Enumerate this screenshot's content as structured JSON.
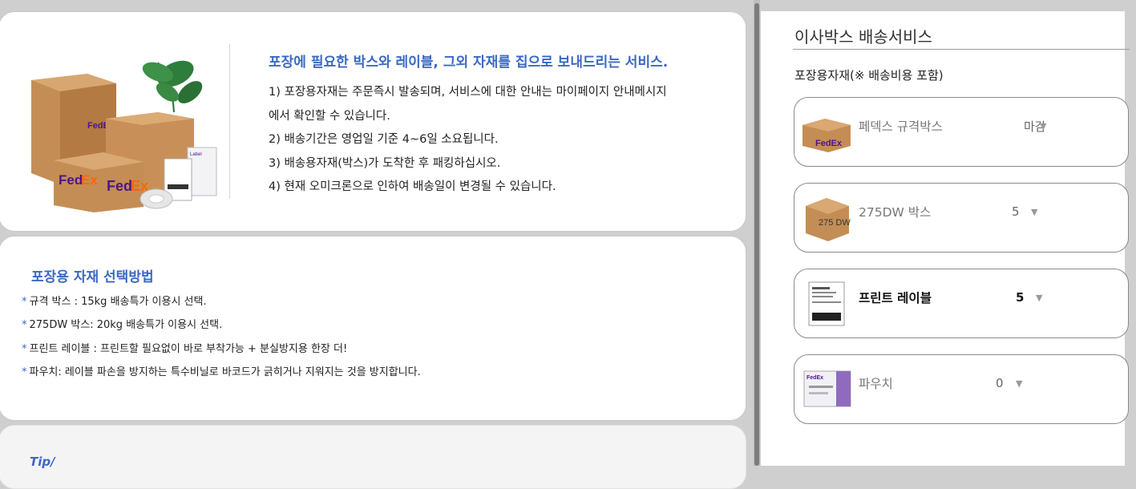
{
  "intro": {
    "title": "포장에 필요한 박스와 레이블, 그외 자재를 집으로 보내드리는 서비스.",
    "lines": [
      "1) 포장용자재는 주문즉시 발송되며, 서비스에 대한 안내는 마이페이지 안내메시지",
      "에서 확인할 수 있습니다.",
      "2) 배송기간은 영업일 기준 4~6일 소요됩니다.",
      "3) 배송용자재(박스)가 도착한 후 패킹하십시오.",
      "4) 현재 오미크론으로 인하여 배송일이 변경될 수 있습니다."
    ],
    "image_brand": "FedEx",
    "image_label_text": "Label"
  },
  "selection": {
    "title": "포장용 자재 선택방법",
    "bullet": "*",
    "items": [
      "규격 박스 : 15kg 배송특가 이용시 선택.",
      "275DW 박스: 20kg 배송특가 이용시 선택.",
      "프린트 레이블 : 프린트할 필요없이 바로 부착가능 + 분실방지용 한장 더!",
      "파우치: 레이블 파손을 방지하는 특수비닐로 바코드가 긁히거나 지워지는 것을 방지합니다."
    ]
  },
  "tip": {
    "title": "Tip/"
  },
  "panel": {
    "title": "이사박스 배송서비스",
    "section_label": "포장용자재(※ 배송비용 포함)",
    "items": [
      {
        "name": "페덱스 규격박스",
        "qty": "마감",
        "thumb_text": "FedEx"
      },
      {
        "name": "275DW 박스",
        "qty": "5",
        "thumb_text": "275 DW"
      },
      {
        "name": "프린트 레이블",
        "qty": "5"
      },
      {
        "name": "파우치",
        "qty": "0",
        "thumb_text": "FedEx"
      }
    ],
    "caret_icon": "▼"
  },
  "colors": {
    "accent_blue": "#3a68c4",
    "fedex_purple": "#4d148c",
    "fedex_orange": "#ff6600",
    "cardboard": "#c48d55"
  }
}
